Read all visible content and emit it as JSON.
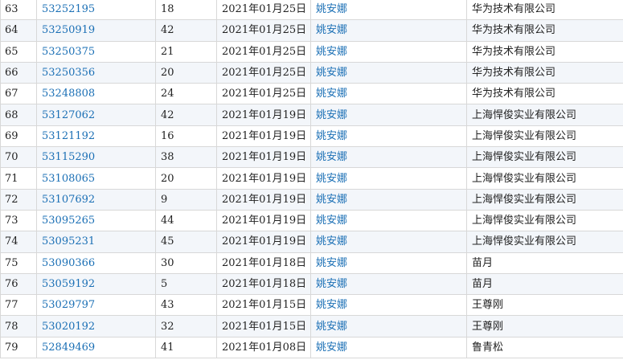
{
  "table": {
    "rows": [
      {
        "no": "63",
        "id": "53252195",
        "cls": "18",
        "date": "2021年01月25日",
        "agent": "姚安娜",
        "applicant": "华为技术有限公司"
      },
      {
        "no": "64",
        "id": "53250919",
        "cls": "42",
        "date": "2021年01月25日",
        "agent": "姚安娜",
        "applicant": "华为技术有限公司"
      },
      {
        "no": "65",
        "id": "53250375",
        "cls": "21",
        "date": "2021年01月25日",
        "agent": "姚安娜",
        "applicant": "华为技术有限公司"
      },
      {
        "no": "66",
        "id": "53250356",
        "cls": "20",
        "date": "2021年01月25日",
        "agent": "姚安娜",
        "applicant": "华为技术有限公司"
      },
      {
        "no": "67",
        "id": "53248808",
        "cls": "24",
        "date": "2021年01月25日",
        "agent": "姚安娜",
        "applicant": "华为技术有限公司"
      },
      {
        "no": "68",
        "id": "53127062",
        "cls": "42",
        "date": "2021年01月19日",
        "agent": "姚安娜",
        "applicant": "上海悍俊实业有限公司"
      },
      {
        "no": "69",
        "id": "53121192",
        "cls": "16",
        "date": "2021年01月19日",
        "agent": "姚安娜",
        "applicant": "上海悍俊实业有限公司"
      },
      {
        "no": "70",
        "id": "53115290",
        "cls": "38",
        "date": "2021年01月19日",
        "agent": "姚安娜",
        "applicant": "上海悍俊实业有限公司"
      },
      {
        "no": "71",
        "id": "53108065",
        "cls": "20",
        "date": "2021年01月19日",
        "agent": "姚安娜",
        "applicant": "上海悍俊实业有限公司"
      },
      {
        "no": "72",
        "id": "53107692",
        "cls": "9",
        "date": "2021年01月19日",
        "agent": "姚安娜",
        "applicant": "上海悍俊实业有限公司"
      },
      {
        "no": "73",
        "id": "53095265",
        "cls": "44",
        "date": "2021年01月19日",
        "agent": "姚安娜",
        "applicant": "上海悍俊实业有限公司"
      },
      {
        "no": "74",
        "id": "53095231",
        "cls": "45",
        "date": "2021年01月19日",
        "agent": "姚安娜",
        "applicant": "上海悍俊实业有限公司"
      },
      {
        "no": "75",
        "id": "53090366",
        "cls": "30",
        "date": "2021年01月18日",
        "agent": "姚安娜",
        "applicant": "苗月"
      },
      {
        "no": "76",
        "id": "53059192",
        "cls": "5",
        "date": "2021年01月18日",
        "agent": "姚安娜",
        "applicant": "苗月"
      },
      {
        "no": "77",
        "id": "53029797",
        "cls": "43",
        "date": "2021年01月15日",
        "agent": "姚安娜",
        "applicant": "王尊刚"
      },
      {
        "no": "78",
        "id": "53020192",
        "cls": "32",
        "date": "2021年01月15日",
        "agent": "姚安娜",
        "applicant": "王尊刚"
      },
      {
        "no": "79",
        "id": "52849469",
        "cls": "41",
        "date": "2021年01月08日",
        "agent": "姚安娜",
        "applicant": "鲁青松"
      }
    ]
  },
  "colors": {
    "link": "#1a6fb5",
    "row_alt": "#f3f6fa",
    "border": "#d8d8d8"
  }
}
